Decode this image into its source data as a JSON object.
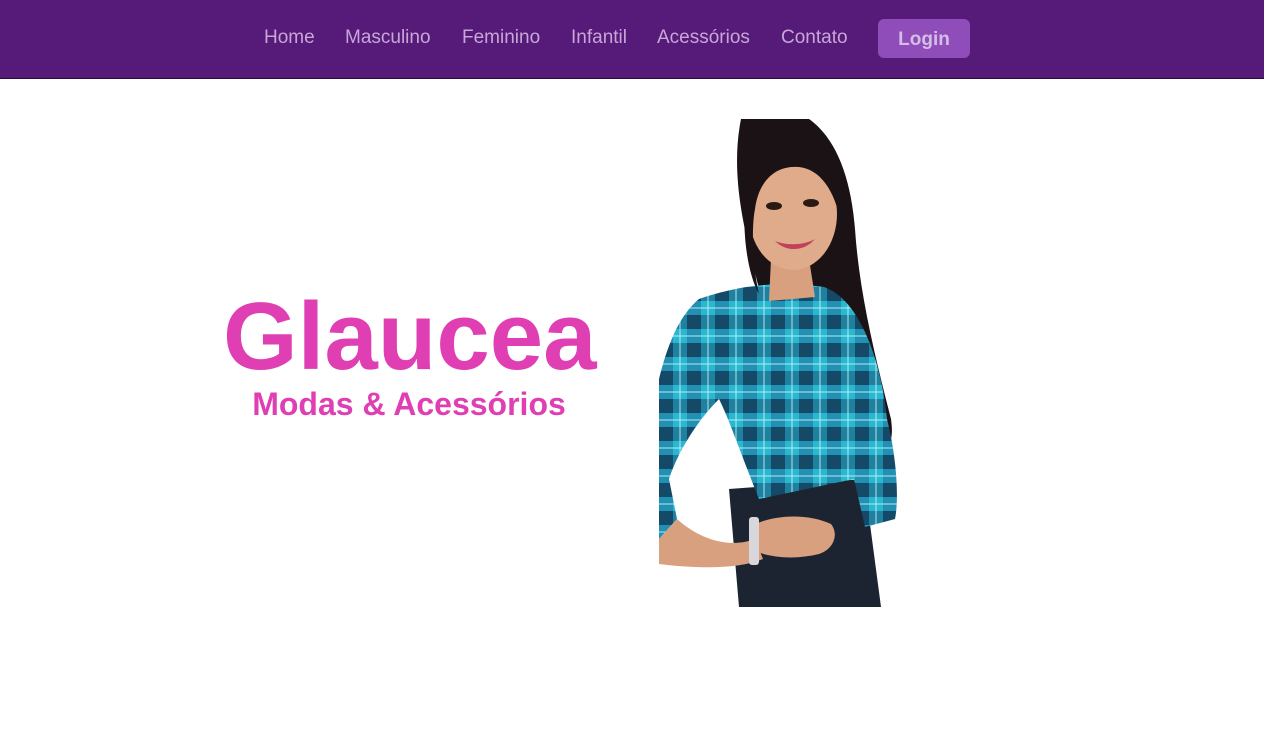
{
  "nav": {
    "items": [
      {
        "label": "Home"
      },
      {
        "label": "Masculino"
      },
      {
        "label": "Feminino"
      },
      {
        "label": "Infantil"
      },
      {
        "label": "Acessórios"
      },
      {
        "label": "Contato"
      }
    ],
    "login_label": "Login"
  },
  "hero": {
    "brand_name": "Glaucea",
    "tagline": "Modas & Acessórios"
  },
  "colors": {
    "topbar": "#561a78",
    "nav_text": "#c7a6d8",
    "login_bg": "#8e4db8",
    "brand_pink": "#e03fb4"
  }
}
